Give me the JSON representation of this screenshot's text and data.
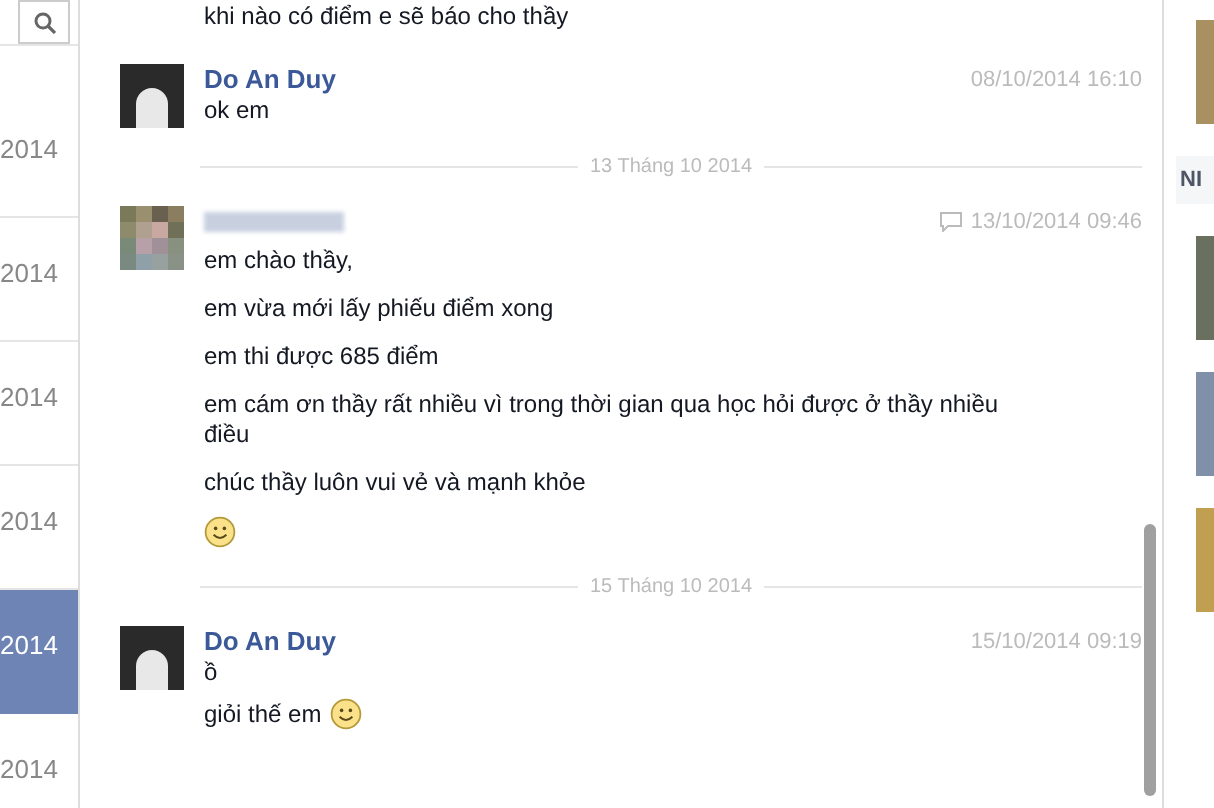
{
  "sidebar": {
    "items": [
      {
        "date": "2014",
        "selected": false
      },
      {
        "date": "2014",
        "selected": false
      },
      {
        "date": "2014",
        "selected": false
      },
      {
        "date": "2014",
        "selected": false
      },
      {
        "date": "2014",
        "selected": true
      },
      {
        "date": "2014",
        "selected": false
      }
    ]
  },
  "conversation": [
    {
      "kind": "continuation",
      "lines": [
        "khi nào có điểm e sẽ báo cho thầy"
      ]
    },
    {
      "kind": "message",
      "sender": "Do An Duy",
      "blurred": false,
      "time": "08/10/2014 16:10",
      "via_chat": false,
      "lines": [
        "ok em"
      ]
    },
    {
      "kind": "divider",
      "label": "13 Tháng 10 2014"
    },
    {
      "kind": "message",
      "blurred": true,
      "time": "13/10/2014 09:46",
      "via_chat": true,
      "lines": [
        "em chào thầy,",
        "em vừa mới lấy phiếu điểm xong",
        "em thi được 685 điểm",
        "em cám ơn thầy rất nhiều vì trong thời gian qua học hỏi được ở thầy nhiều điều",
        "chúc thầy luôn vui vẻ và mạnh khỏe"
      ],
      "smiley": true
    },
    {
      "kind": "divider",
      "label": "15 Tháng 10 2014"
    },
    {
      "kind": "message",
      "sender": "Do An Duy",
      "blurred": false,
      "time": "15/10/2014 09:19",
      "via_chat": false,
      "lines": [
        "ồ",
        "giỏi thế em"
      ],
      "smiley_inline": true
    }
  ],
  "right_panel": {
    "heading": "NI"
  }
}
